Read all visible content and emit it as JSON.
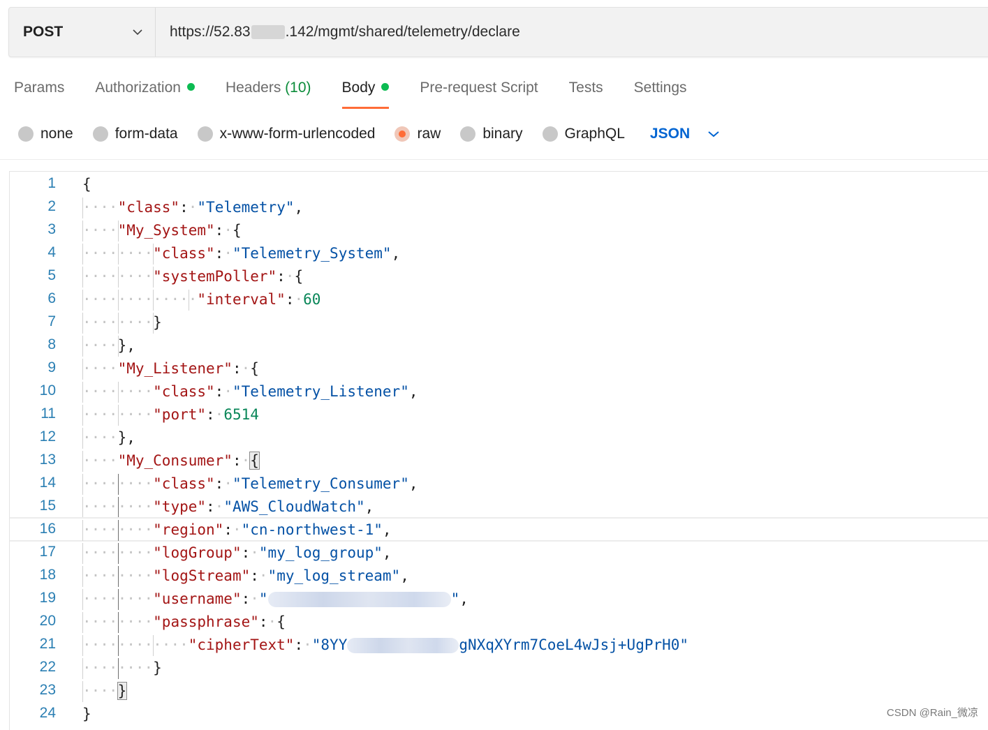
{
  "request": {
    "method": "POST",
    "url_prefix": "https://52.83",
    "url_suffix": ".142/mgmt/shared/telemetry/declare"
  },
  "tabs": [
    {
      "label": "Params"
    },
    {
      "label": "Authorization",
      "indicator": "green-dot"
    },
    {
      "label": "Headers",
      "count": "(10)"
    },
    {
      "label": "Body",
      "indicator": "green-dot",
      "active": true
    },
    {
      "label": "Pre-request Script"
    },
    {
      "label": "Tests"
    },
    {
      "label": "Settings"
    }
  ],
  "body_types": {
    "options": [
      "none",
      "form-data",
      "x-www-form-urlencoded",
      "raw",
      "binary",
      "GraphQL"
    ],
    "selected": "raw",
    "language": "JSON"
  },
  "editor": {
    "line_numbers": [
      "1",
      "2",
      "3",
      "4",
      "5",
      "6",
      "7",
      "8",
      "9",
      "10",
      "11",
      "12",
      "13",
      "14",
      "15",
      "16",
      "17",
      "18",
      "19",
      "20",
      "21",
      "22",
      "23",
      "24"
    ],
    "highlighted_line": "16",
    "tokens": {
      "k_class": "\"class\"",
      "v_telemetry": "\"Telemetry\"",
      "k_my_system": "\"My_System\"",
      "v_telemetry_system": "\"Telemetry_System\"",
      "k_systempoller": "\"systemPoller\"",
      "k_interval": "\"interval\"",
      "v_interval": "60",
      "k_my_listener": "\"My_Listener\"",
      "v_telemetry_listener": "\"Telemetry_Listener\"",
      "k_port": "\"port\"",
      "v_port": "6514",
      "k_my_consumer": "\"My_Consumer\"",
      "v_telemetry_consumer": "\"Telemetry_Consumer\"",
      "k_type": "\"type\"",
      "v_type": "\"AWS_CloudWatch\"",
      "k_region": "\"region\"",
      "v_region": "\"cn-northwest-1\"",
      "k_loggroup": "\"logGroup\"",
      "v_loggroup": "\"my_log_group\"",
      "k_logstream": "\"logStream\"",
      "v_logstream": "\"my_log_stream\"",
      "k_username": "\"username\"",
      "v_username_open": "\"",
      "v_username_close": "\"",
      "k_passphrase": "\"passphrase\"",
      "k_ciphertext": "\"cipherText\"",
      "v_cipher_prefix": "\"8YY",
      "v_cipher_suffix": "gNXqXYrm7CoeL4wJsj+UgPrH0\""
    }
  },
  "watermark": "CSDN @Rain_微凉"
}
